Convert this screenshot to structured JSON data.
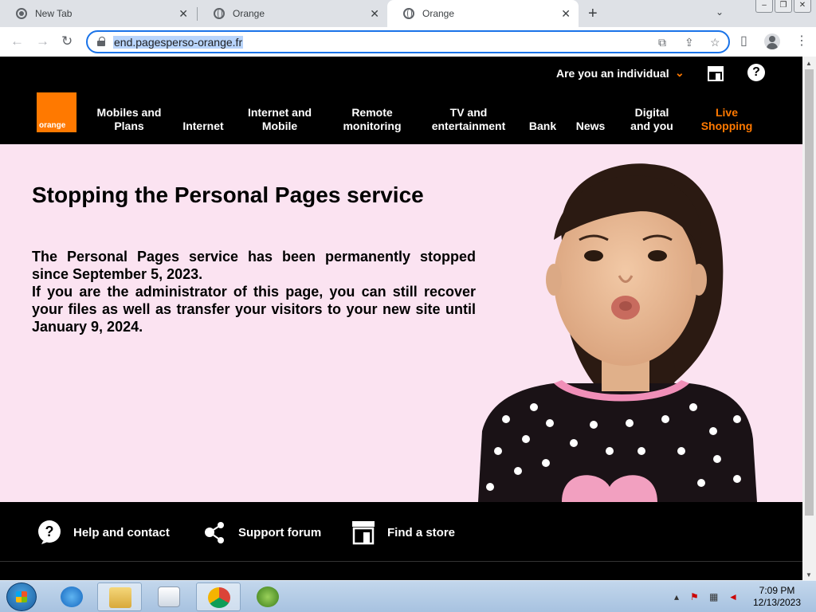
{
  "browser": {
    "tabs": [
      {
        "title": "New Tab",
        "close": "✕"
      },
      {
        "title": "Orange",
        "close": "✕"
      },
      {
        "title": "Orange",
        "close": "✕"
      }
    ],
    "new_tab": "+",
    "tab_search": "⌄",
    "window_buttons": [
      "–",
      "❐",
      "✕"
    ],
    "url": "end.pagesperso-orange.fr"
  },
  "site": {
    "top_bar": {
      "audience": "Are you an individual"
    },
    "logo_text": "orange",
    "nav": [
      {
        "line1": "Mobiles and",
        "line2": "Plans"
      },
      {
        "line1": "",
        "line2": "Internet"
      },
      {
        "line1": "Internet and",
        "line2": "Mobile"
      },
      {
        "line1": "Remote",
        "line2": "monitoring"
      },
      {
        "line1": "TV and",
        "line2": "entertainment"
      },
      {
        "line1": "",
        "line2": "Bank"
      },
      {
        "line1": "",
        "line2": "News"
      },
      {
        "line1": "Digital",
        "line2": "and you"
      },
      {
        "line1": "Live",
        "line2": "Shopping"
      }
    ],
    "hero": {
      "title": "Stopping the Personal Pages service",
      "para1": "The Personal Pages service has been permanently stopped since September 5, 2023.",
      "para2": "If you are the administrator of this page, you can still recover your files as well as transfer your visitors to your new site until January 9, 2024."
    },
    "footer": {
      "help": "Help and contact",
      "forum": "Support forum",
      "store": "Find a store"
    }
  },
  "taskbar": {
    "time": "7:09 PM",
    "date": "12/13/2023"
  },
  "colors": {
    "brand_orange": "#ff7900",
    "hero_bg": "#fbe3f1",
    "omnibox_focus": "#1a73e8"
  }
}
